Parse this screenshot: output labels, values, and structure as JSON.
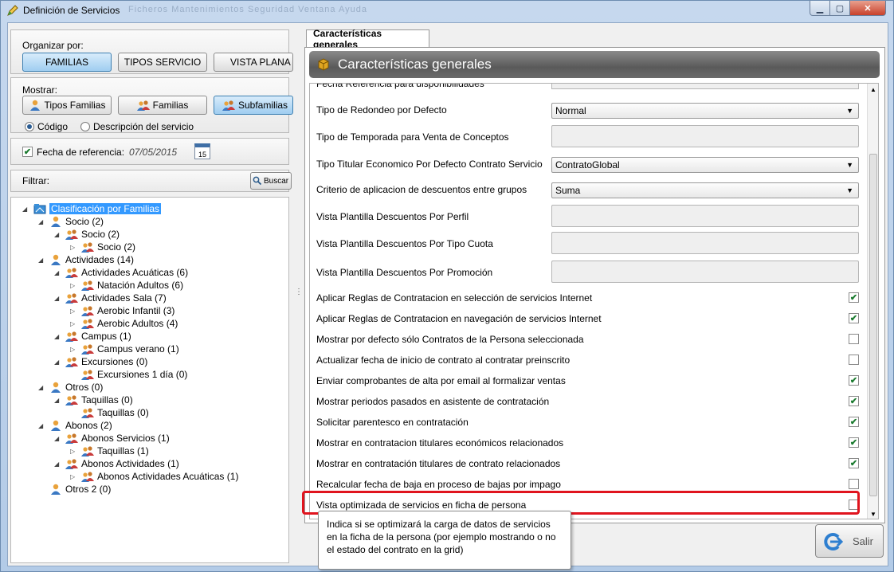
{
  "window": {
    "title": "Definición de Servicios",
    "faded_menu": "Ficheros   Mantenimientos   Seguridad   Ventana   Ayuda",
    "min_glyph": "▁",
    "max_glyph": "▢",
    "close_glyph": "✕"
  },
  "organize": {
    "label": "Organizar por:",
    "buttons": [
      "FAMILIAS",
      "TIPOS SERVICIO",
      "VISTA PLANA"
    ],
    "active": "FAMILIAS"
  },
  "show": {
    "label": "Mostrar:",
    "buttons": [
      "Tipos Familias",
      "Familias",
      "Subfamilias"
    ],
    "active": "Subfamilias",
    "radio_code": "Código",
    "radio_desc": "Descripción del servicio",
    "radio_selected": "Código"
  },
  "reference_date": {
    "label": "Fecha de referencia:",
    "value": "07/05/2015",
    "checked": true,
    "calendar_day": "15"
  },
  "filter": {
    "label": "Filtrar:",
    "search_label": "Buscar"
  },
  "tree": {
    "root": "Clasificación por Familias",
    "nodes": [
      {
        "label": "Socio (2)",
        "level": 1,
        "expand": "◢"
      },
      {
        "label": "Socio (2)",
        "level": 2,
        "expand": "◢"
      },
      {
        "label": "Socio (2)",
        "level": 3,
        "expand": "▷"
      },
      {
        "label": "Actividades (14)",
        "level": 1,
        "expand": "◢"
      },
      {
        "label": "Actividades Acuáticas (6)",
        "level": 2,
        "expand": "◢"
      },
      {
        "label": "Natación Adultos (6)",
        "level": 3,
        "expand": "▷"
      },
      {
        "label": "Actividades Sala (7)",
        "level": 2,
        "expand": "◢"
      },
      {
        "label": "Aerobic Infantil (3)",
        "level": 3,
        "expand": "▷"
      },
      {
        "label": "Aerobic Adultos (4)",
        "level": 3,
        "expand": "▷"
      },
      {
        "label": "Campus (1)",
        "level": 2,
        "expand": "◢"
      },
      {
        "label": "Campus verano (1)",
        "level": 3,
        "expand": "▷"
      },
      {
        "label": "Excursiones (0)",
        "level": 2,
        "expand": "◢"
      },
      {
        "label": "Excursiones 1 día (0)",
        "level": 3,
        "expand": ""
      },
      {
        "label": "Otros (0)",
        "level": 1,
        "expand": "◢"
      },
      {
        "label": "Taquillas (0)",
        "level": 2,
        "expand": "◢"
      },
      {
        "label": "Taquillas (0)",
        "level": 3,
        "expand": ""
      },
      {
        "label": "Abonos (2)",
        "level": 1,
        "expand": "◢"
      },
      {
        "label": "Abonos Servicios (1)",
        "level": 2,
        "expand": "◢"
      },
      {
        "label": "Taquillas (1)",
        "level": 3,
        "expand": "▷"
      },
      {
        "label": "Abonos Actividades (1)",
        "level": 2,
        "expand": "◢"
      },
      {
        "label": "Abonos Actividades Acuáticas (1)",
        "level": 3,
        "expand": "▷"
      },
      {
        "label": "Otros 2 (0)",
        "level": 1,
        "expand": ""
      }
    ]
  },
  "tab": {
    "label": "Características generales"
  },
  "section_header": "Características generales",
  "properties": {
    "top_partial": "Fecha Referencia para disponibilidades",
    "combos": [
      {
        "label": "Tipo de Redondeo por Defecto",
        "value": "Normal"
      },
      {
        "label": "Tipo Titular Economico Por Defecto Contrato Servicio",
        "value": "ContratoGlobal"
      },
      {
        "label": "Criterio de aplicacion de descuentos entre grupos",
        "value": "Suma"
      }
    ],
    "textboxes": [
      {
        "label": "Tipo de Temporada para Venta de Conceptos"
      },
      {
        "label": "Vista Plantilla Descuentos Por Perfil"
      },
      {
        "label": "Vista Plantilla Descuentos Por Tipo Cuota"
      },
      {
        "label": "Vista Plantilla Descuentos Por Promoción"
      }
    ],
    "checkboxes": [
      {
        "label": "Aplicar Reglas de Contratacion en selección de servicios Internet",
        "checked": true
      },
      {
        "label": "Aplicar Reglas de Contratacion en navegación de servicios Internet",
        "checked": true
      },
      {
        "label": "Mostrar por defecto sólo Contratos de la Persona seleccionada",
        "checked": false
      },
      {
        "label": "Actualizar fecha de inicio de contrato al contratar preinscrito",
        "checked": false
      },
      {
        "label": "Enviar comprobantes de alta por email al formalizar ventas",
        "checked": true
      },
      {
        "label": "Mostrar periodos pasados en asistente de contratación",
        "checked": true
      },
      {
        "label": "Solicitar parentesco en contratación",
        "checked": true
      },
      {
        "label": "Mostrar en contratacion titulares económicos relacionados",
        "checked": true
      },
      {
        "label": "Mostrar en contratación titulares de contrato relacionados",
        "checked": true
      },
      {
        "label": "Recalcular fecha de baja en proceso de bajas por impago",
        "checked": false
      },
      {
        "label": "Vista optimizada de servicios en ficha de persona",
        "checked": false
      }
    ]
  },
  "tooltip": "Indica si se optimizará la carga de datos de servicios en la ficha de la persona (por ejemplo mostrando o no el estado del contrato en la grid)",
  "exit_button": "Salir",
  "colors": {
    "highlight": "#e0141e",
    "check": "#1a7a2e",
    "tree_selected": "#3399ff"
  }
}
